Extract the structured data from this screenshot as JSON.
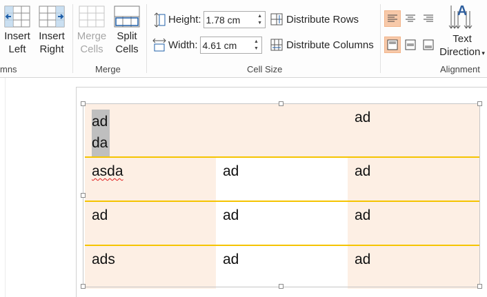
{
  "ribbon": {
    "columns_group": {
      "label_partial": "mns",
      "insert_left": {
        "line1": "Insert",
        "line2": "Left"
      },
      "insert_right": {
        "line1": "Insert",
        "line2": "Right"
      }
    },
    "merge_group": {
      "label": "Merge",
      "merge_cells": {
        "line1": "Merge",
        "line2": "Cells",
        "enabled": false
      },
      "split_cells": {
        "line1": "Split",
        "line2": "Cells",
        "enabled": true
      }
    },
    "cell_size_group": {
      "label": "Cell Size",
      "height_label": "Height:",
      "height_value": "1.78 cm",
      "width_label": "Width:",
      "width_value": "4.61 cm",
      "distribute_rows": "Distribute Rows",
      "distribute_columns": "Distribute Columns"
    },
    "alignment_group": {
      "label": "Alignment",
      "text_direction": {
        "line1": "Text",
        "line2": "Direction"
      },
      "active_alignment": [
        "top-left",
        "align-top-row-first"
      ]
    }
  },
  "colors": {
    "selected_cell_fill": "#fdefe4",
    "row_border": "#f5c400",
    "active_button": "#f7c9a9",
    "text_selection": "#bfbfbf",
    "text_direction_icon": "#2f5f9e"
  },
  "table": {
    "rows": [
      [
        "ad\nda",
        "",
        "ad"
      ],
      [
        "asda",
        "ad",
        "ad"
      ],
      [
        "ad",
        "ad",
        "ad"
      ],
      [
        "ads",
        "ad",
        "ad"
      ]
    ],
    "first_cell_lines": [
      "ad",
      "da"
    ]
  }
}
